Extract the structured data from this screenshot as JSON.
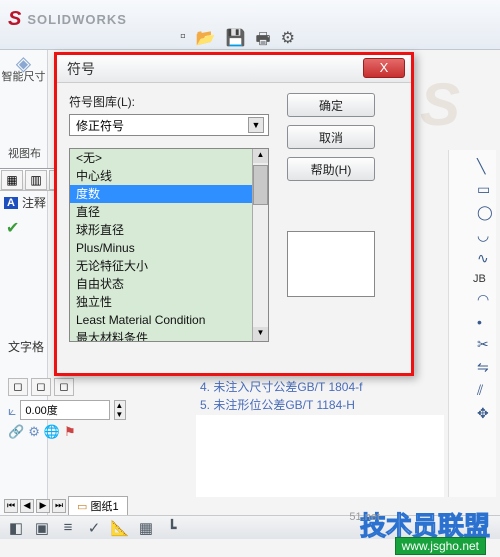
{
  "app": {
    "brand_initial": "S",
    "brand_name": "SOLIDWORKS"
  },
  "toolbar_top": {
    "icons": [
      "new",
      "open",
      "save",
      "print",
      "settings"
    ]
  },
  "left": {
    "smart_dim_icon": "◈",
    "smart_dim_label": "智能尺寸",
    "view_tab_label": "视图布"
  },
  "feature_panel": {
    "annotation_prefix": "A",
    "annotation_label": "注释"
  },
  "text_section_label": "文字格",
  "degree_input": {
    "value": "0.00度"
  },
  "drawing_notes": {
    "line4": "4. 未注入尺寸公差GB/T 1804-f",
    "line5": "5. 未注形位公差GB/T 1184-H"
  },
  "sheet": {
    "tab_label": "图纸1"
  },
  "right_rail": {
    "label_jb": "JB"
  },
  "dialog": {
    "title": "符号",
    "close_x": "X",
    "library_label": "符号图库(L):",
    "combo_value": "修正符号",
    "items": [
      "<无>",
      "中心线",
      "度数",
      "直径",
      "球形直径",
      "Plus/Minus",
      "无论特征大小",
      "自由状态",
      "独立性",
      "Least Material Condition",
      "最大材料条件"
    ],
    "selected_index": 2,
    "btn_ok": "确定",
    "btn_cancel": "取消",
    "btn_help": "帮助(H)"
  },
  "watermarks": {
    "big": "技术员联盟",
    "small": "www.jsgho.net",
    "tiny": "51.net"
  }
}
